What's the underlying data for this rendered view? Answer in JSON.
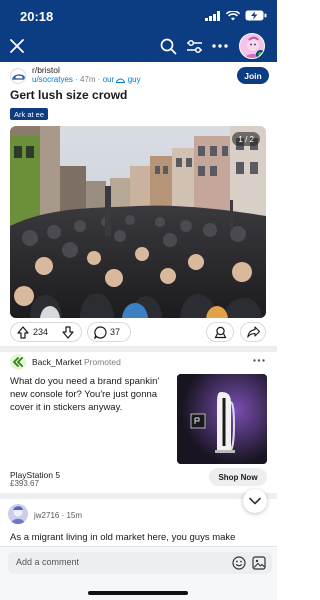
{
  "status_bar": {
    "time": "20:18"
  },
  "post": {
    "subreddit": "r/bristol",
    "author": "u/socratyes",
    "age": "47m",
    "flair": "our",
    "flair_suffix": "guy",
    "join_label": "Join",
    "title": "Gert lush size crowd",
    "tag": "Ark at ee",
    "image_counter": "1 / 2",
    "upvotes": "234",
    "comments": "37"
  },
  "promoted": {
    "advertiser": "Back_Market",
    "promoted_label": "Promoted",
    "text": "What do you need a brand spankin' new console for? You're just gonna cover it in stickers anyway.",
    "product": "PlayStation 5",
    "price": "£393.67",
    "cta": "Shop Now"
  },
  "comment": {
    "user": "jw2716",
    "age": "15m",
    "text": "As a migrant living in old market here, you guys make"
  },
  "composer": {
    "placeholder": "Add a comment"
  }
}
